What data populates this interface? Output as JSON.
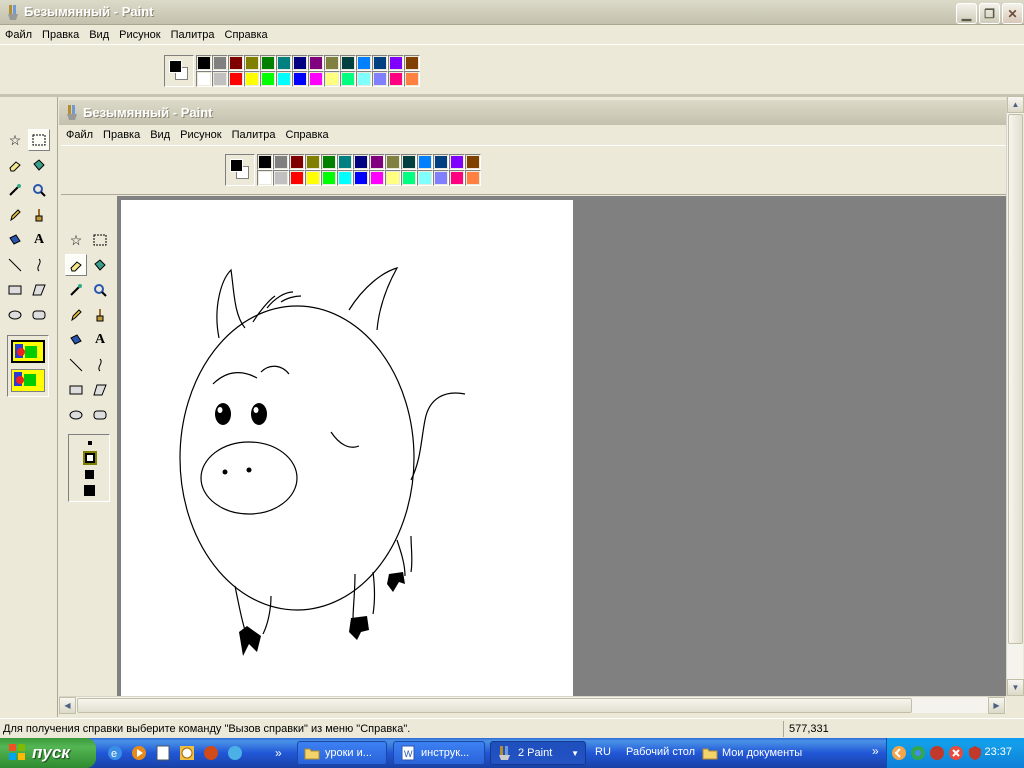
{
  "outer_window": {
    "title": "Безымянный - Paint",
    "menu": [
      "Файл",
      "Правка",
      "Вид",
      "Рисунок",
      "Палитра",
      "Справка"
    ]
  },
  "inner_window": {
    "title": "Безымянный - Paint",
    "menu": [
      "Файл",
      "Правка",
      "Вид",
      "Рисунок",
      "Палитра",
      "Справка"
    ]
  },
  "palette": {
    "foreground": "#000000",
    "background": "#ffffff",
    "row1": [
      "#000000",
      "#808080",
      "#800000",
      "#808000",
      "#008000",
      "#008080",
      "#000080",
      "#800080",
      "#808040",
      "#004040",
      "#0080ff",
      "#004080",
      "#8000ff",
      "#804000"
    ],
    "row2": [
      "#ffffff",
      "#c0c0c0",
      "#ff0000",
      "#ffff00",
      "#00ff00",
      "#00ffff",
      "#0000ff",
      "#ff00ff",
      "#ffff80",
      "#00ff80",
      "#80ffff",
      "#8080ff",
      "#ff0080",
      "#ff8040"
    ]
  },
  "tools": [
    "free-select",
    "rect-select",
    "eraser",
    "fill",
    "color-picker",
    "magnifier",
    "pencil",
    "brush",
    "airbrush",
    "text",
    "line",
    "curve",
    "rectangle",
    "polygon",
    "ellipse",
    "rounded-rectangle"
  ],
  "status": {
    "help_text": "Для получения справки выберите команду \"Вызов справки\" из меню \"Справка\".",
    "coords": "577,331"
  },
  "taskbar": {
    "start_label": "пуск",
    "buttons": [
      {
        "label": "уроки и...",
        "icon": "folder-icon"
      },
      {
        "label": "инструк...",
        "icon": "word-icon"
      },
      {
        "label": "2 Paint",
        "icon": "paint-icon"
      }
    ],
    "language": "RU",
    "desktop_label": "Рабочий стол",
    "docs_label": "Мои документы",
    "clock": "23:37"
  },
  "colors": {
    "workspace_gray": "#808080",
    "canvas": "#ffffff",
    "window_face": "#ece9d8"
  }
}
